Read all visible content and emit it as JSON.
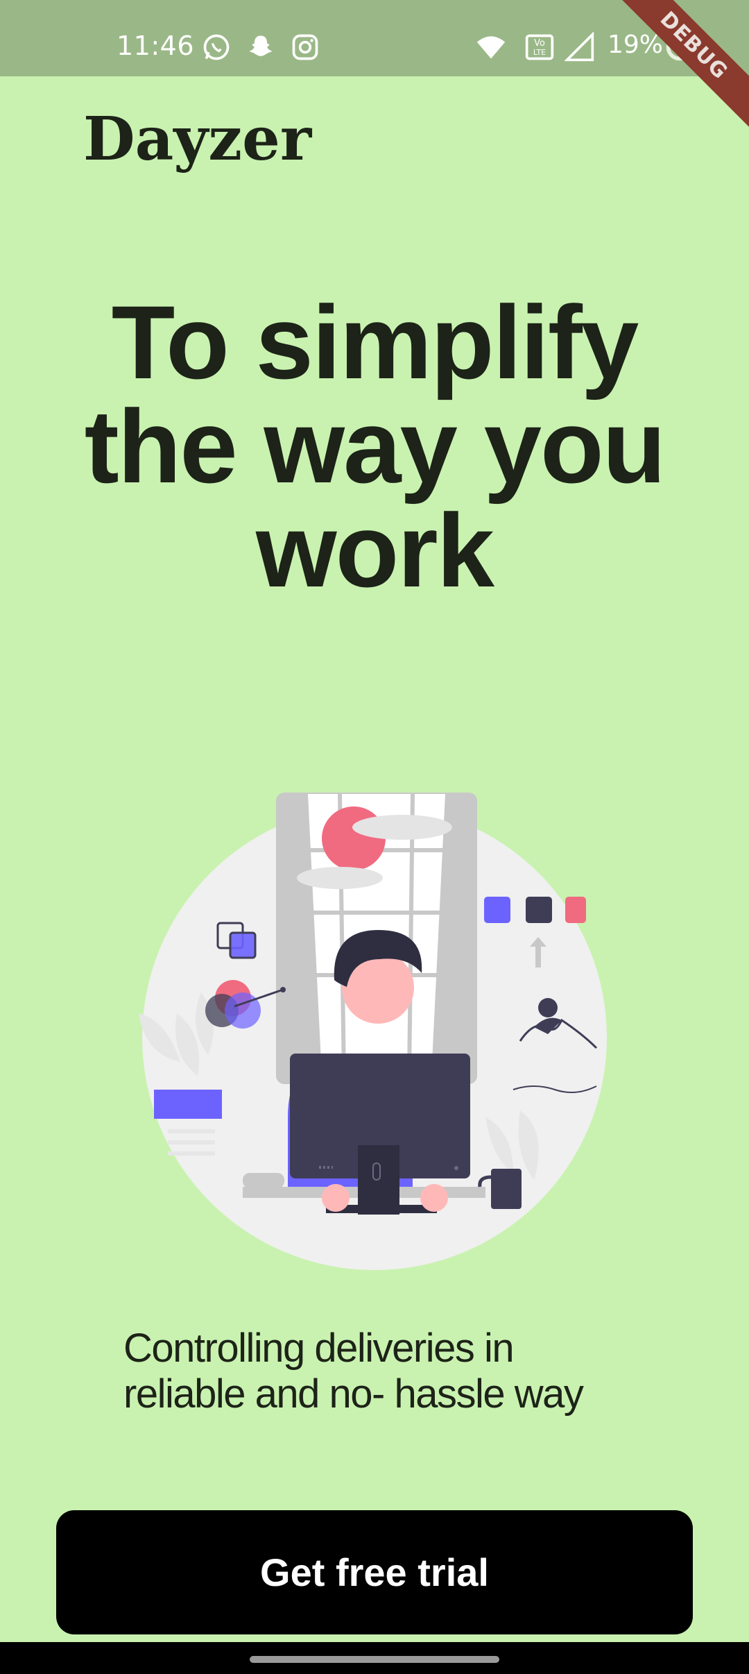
{
  "status_bar": {
    "time": "11:46",
    "battery": "19%",
    "debug_label": "DEBUG",
    "icons": [
      "whatsapp-icon",
      "snapchat-icon",
      "instagram-icon",
      "wifi-icon",
      "volte-icon",
      "signal-icon",
      "battery-icon"
    ]
  },
  "app": {
    "brand": "Dayzer",
    "headline_lines": [
      "To simplify",
      "the way you",
      "work"
    ],
    "tagline_lines": [
      "Controlling deliveries in",
      "reliable and no- hassle way"
    ],
    "cta_label": "Get free trial"
  },
  "colors": {
    "background": "#c9f2b0",
    "status_bar": "#9ab887",
    "button": "#000000",
    "accent_purple": "#6c63ff",
    "accent_pink": "#f06b80",
    "dark": "#3f3d56"
  }
}
